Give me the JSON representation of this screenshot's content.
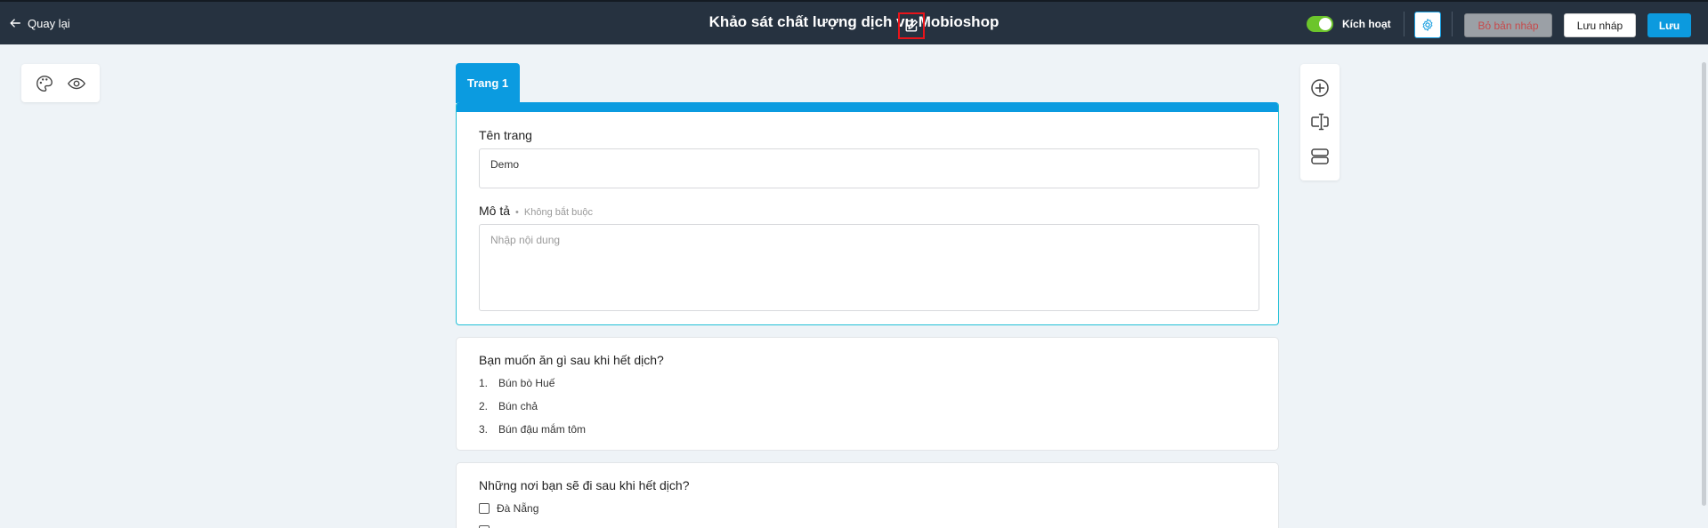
{
  "header": {
    "back_label": "Quay lại",
    "survey_title": "Khảo sát chất lượng dịch vụ Mobioshop",
    "active_label": "Kích hoạt",
    "active": true,
    "discard_draft_label": "Bỏ bản nháp",
    "save_draft_label": "Lưu nháp",
    "save_label": "Lưu"
  },
  "page": {
    "tab_label": "Trang 1",
    "name_label": "Tên trang",
    "name_value": "Demo",
    "description_label": "Mô tả",
    "optional_dot": "•",
    "optional_note": "Không bắt buộc",
    "description_placeholder": "Nhập nội dung"
  },
  "questions": [
    {
      "title": "Bạn muốn ăn gì sau khi hết dịch?",
      "type": "ordered",
      "options": [
        {
          "num": "1.",
          "label": "Bún bò Huế"
        },
        {
          "num": "2.",
          "label": "Bún chả"
        },
        {
          "num": "3.",
          "label": "Bún đậu mắm tôm"
        }
      ]
    },
    {
      "title": "Những nơi bạn sẽ đi sau khi hết dịch?",
      "type": "checkbox",
      "options": [
        {
          "label": "Đà Nẵng"
        },
        {
          "label": ""
        }
      ]
    }
  ],
  "colors": {
    "header_bg": "#263240",
    "accent": "#0b9be0",
    "toggle_on": "#6cc52b",
    "highlight": "#e8141a"
  },
  "icons": {
    "back": "arrow-left-icon",
    "edit_title": "pencil-square-icon",
    "settings": "gear-icon",
    "palette": "palette-icon",
    "preview": "eye-icon",
    "add": "plus-circle-icon",
    "text": "text-cursor-icon",
    "section": "section-stack-icon"
  }
}
